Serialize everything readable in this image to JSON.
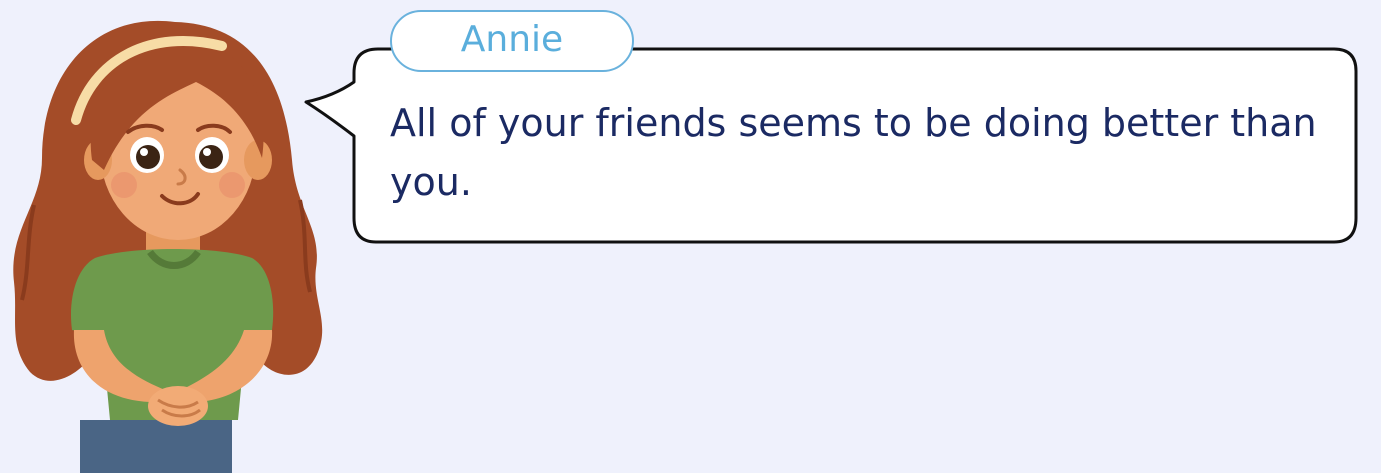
{
  "speaker": {
    "name": "Annie"
  },
  "dialogue": {
    "text": "All of your friends seems to be doing better than you."
  },
  "colors": {
    "background": "#eff1fc",
    "name_tag_border": "#6ab2dd",
    "name_tag_text": "#5aaedc",
    "dialogue_text": "#1b2a63",
    "bubble_border": "#111111"
  },
  "illustration": {
    "character": "girl-with-long-auburn-hair-green-shirt"
  }
}
